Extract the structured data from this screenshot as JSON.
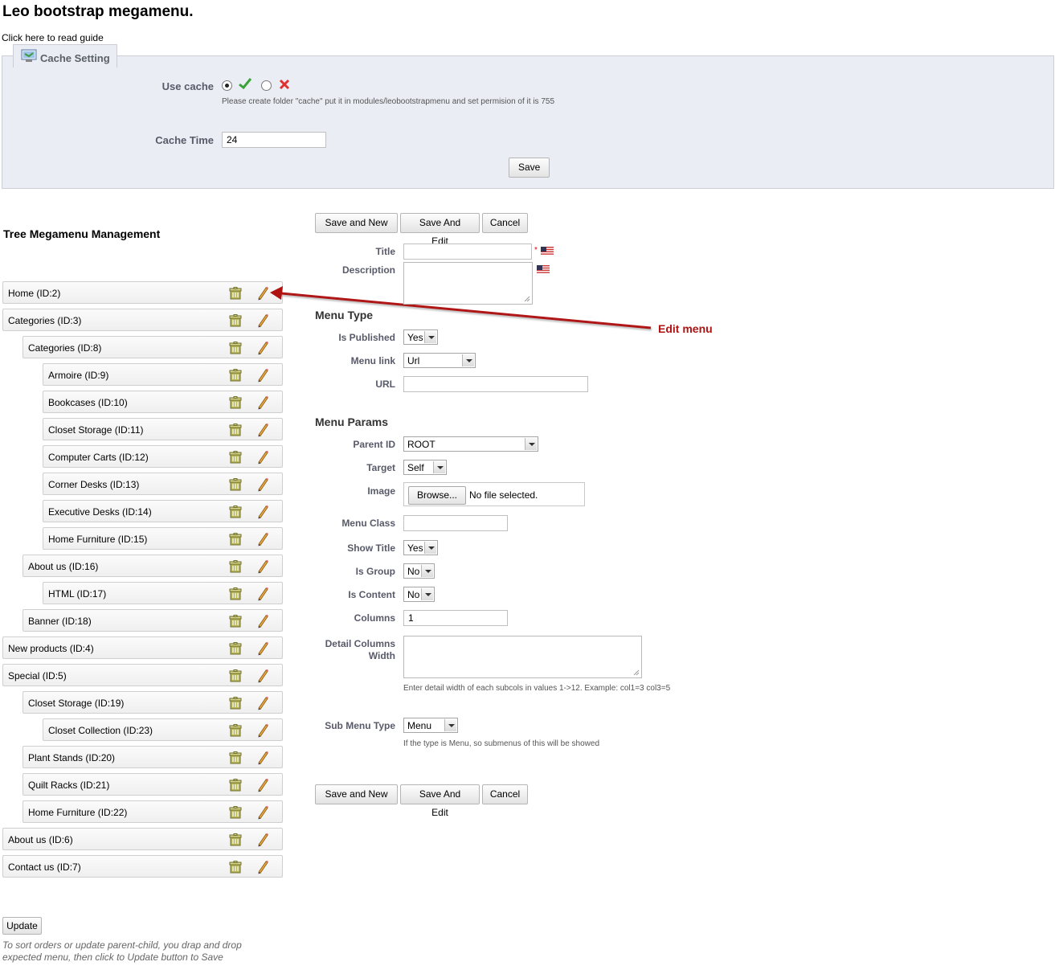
{
  "page": {
    "title": "Leo bootstrap megamenu.",
    "guide_link": "Click here to read guide"
  },
  "cache": {
    "legend": "Cache Setting",
    "use_cache_label": "Use cache",
    "use_cache_value": "yes",
    "use_cache_hint": "Please create folder \"cache\" put it in modules/leobootstrapmenu and set permision of it is 755",
    "cache_time_label": "Cache Time",
    "cache_time_value": "24",
    "save_label": "Save"
  },
  "tree": {
    "title": "Tree Megamenu Management",
    "items": [
      {
        "label": "Home (ID:2)",
        "level": 0
      },
      {
        "label": "Categories (ID:3)",
        "level": 0
      },
      {
        "label": "Categories (ID:8)",
        "level": 1
      },
      {
        "label": "Armoire (ID:9)",
        "level": 2
      },
      {
        "label": "Bookcases (ID:10)",
        "level": 2
      },
      {
        "label": "Closet Storage (ID:11)",
        "level": 2
      },
      {
        "label": "Computer Carts (ID:12)",
        "level": 2
      },
      {
        "label": "Corner Desks (ID:13)",
        "level": 2
      },
      {
        "label": "Executive Desks (ID:14)",
        "level": 2
      },
      {
        "label": "Home Furniture (ID:15)",
        "level": 2
      },
      {
        "label": "About us (ID:16)",
        "level": 1
      },
      {
        "label": "HTML (ID:17)",
        "level": 2
      },
      {
        "label": "Banner (ID:18)",
        "level": 1
      },
      {
        "label": "New products (ID:4)",
        "level": 0
      },
      {
        "label": "Special (ID:5)",
        "level": 0
      },
      {
        "label": "Closet Storage (ID:19)",
        "level": 1
      },
      {
        "label": "Closet Collection (ID:23)",
        "level": 2
      },
      {
        "label": "Plant Stands (ID:20)",
        "level": 1
      },
      {
        "label": "Quilt Racks (ID:21)",
        "level": 1
      },
      {
        "label": "Home Furniture (ID:22)",
        "level": 1
      },
      {
        "label": "About us (ID:6)",
        "level": 0
      },
      {
        "label": "Contact us (ID:7)",
        "level": 0
      }
    ],
    "update_label": "Update",
    "note": "To sort orders or update parent-child, you drap and drop expected menu, then click to Update button to Save"
  },
  "form": {
    "buttons": {
      "save_new": "Save and New",
      "save_edit": "Save And Edit",
      "cancel": "Cancel"
    },
    "title_label": "Title",
    "title_value": "",
    "description_label": "Description",
    "menu_type_heading": "Menu Type",
    "is_published_label": "Is Published",
    "is_published_value": "Yes",
    "menu_link_label": "Menu link",
    "menu_link_value": "Url",
    "url_label": "URL",
    "url_value": "",
    "menu_params_heading": "Menu Params",
    "parent_id_label": "Parent ID",
    "parent_id_value": "ROOT",
    "target_label": "Target",
    "target_value": "Self",
    "image_label": "Image",
    "browse_label": "Browse...",
    "file_status": "No file selected.",
    "menu_class_label": "Menu Class",
    "menu_class_value": "",
    "show_title_label": "Show Title",
    "show_title_value": "Yes",
    "is_group_label": "Is Group",
    "is_group_value": "No",
    "is_content_label": "Is Content",
    "is_content_value": "No",
    "columns_label": "Columns",
    "columns_value": "1",
    "detail_columns_label_1": "Detail Columns",
    "detail_columns_label_2": "Width",
    "detail_columns_hint": "Enter detail width of each subcols in values 1->12. Example: col1=3 col3=5",
    "sub_menu_type_label": "Sub Menu Type",
    "sub_menu_type_value": "Menu",
    "sub_menu_type_hint": "If the type is Menu, so submenus of this will be showed"
  },
  "annotation": {
    "text": "Edit menu",
    "color": "#b01212"
  },
  "icons": {
    "delete": "trash-icon",
    "edit": "pencil-icon",
    "legend": "cache-setting-icon",
    "yes": "check-icon",
    "no": "cross-icon",
    "language": "us-flag-icon"
  }
}
